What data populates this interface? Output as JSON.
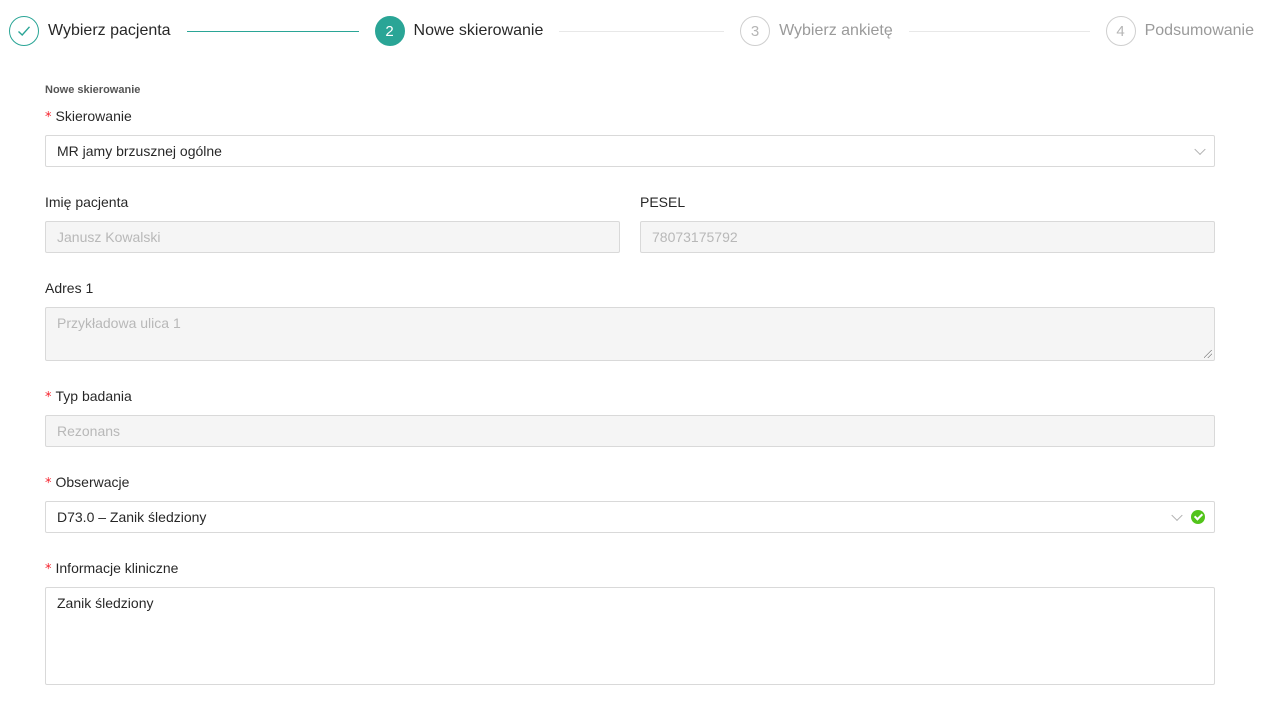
{
  "steps": [
    {
      "number": "1",
      "title": "Wybierz pacjenta",
      "status": "finish"
    },
    {
      "number": "2",
      "title": "Nowe skierowanie",
      "status": "process"
    },
    {
      "number": "3",
      "title": "Wybierz ankietę",
      "status": "wait"
    },
    {
      "number": "4",
      "title": "Podsumowanie",
      "status": "wait"
    }
  ],
  "colors": {
    "accent": "#2aa596",
    "required": "#f5222d",
    "success": "#52c41a"
  },
  "form": {
    "section_title": "Nowe skierowanie",
    "required_mark": "*",
    "referral": {
      "label": "Skierowanie",
      "value": "MR jamy brzusznej ogólne"
    },
    "patient_name": {
      "label": "Imię pacjenta",
      "value": "Janusz Kowalski"
    },
    "pesel": {
      "label": "PESEL",
      "value": "78073175792"
    },
    "address": {
      "label": "Adres 1",
      "value": "Przykładowa ulica 1"
    },
    "exam_type": {
      "label": "Typ badania",
      "value": "Rezonans"
    },
    "observations": {
      "label": "Obserwacje",
      "value": "D73.0 – Zanik śledziony"
    },
    "clinical_info": {
      "label": "Informacje kliniczne",
      "value": "Zanik śledziony"
    }
  }
}
